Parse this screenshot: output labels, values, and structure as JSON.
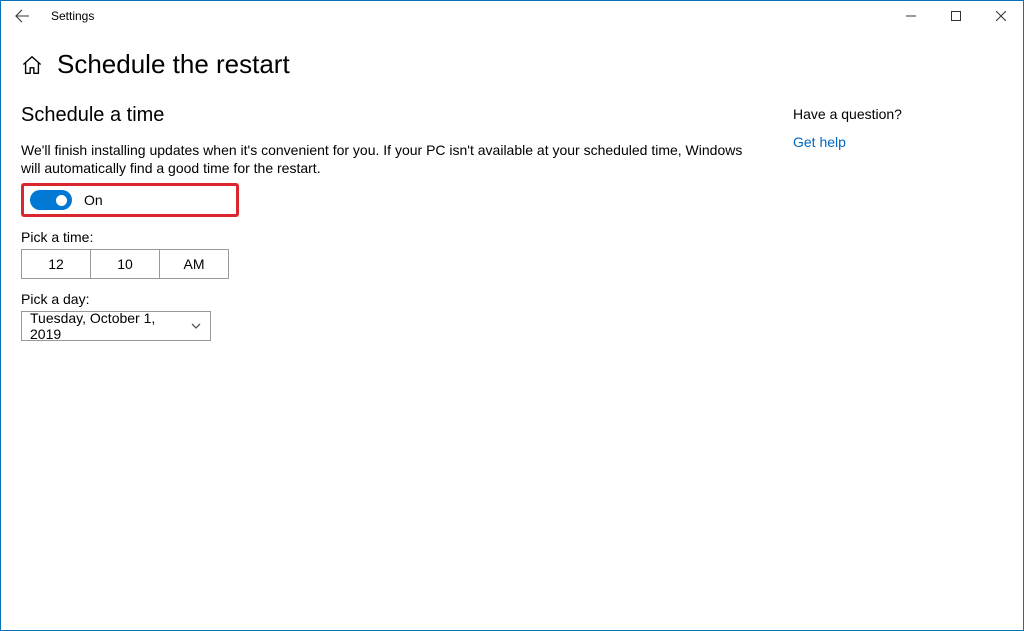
{
  "window": {
    "app_title": "Settings"
  },
  "header": {
    "page_title": "Schedule the restart"
  },
  "main": {
    "section_title": "Schedule a time",
    "description": "We'll finish installing updates when it's convenient for you. If your PC isn't available at your scheduled time, Windows will automatically find a good time for the restart.",
    "toggle": {
      "state": "on",
      "label": "On"
    },
    "pick_time": {
      "label": "Pick a time:",
      "hour": "12",
      "minute": "10",
      "ampm": "AM"
    },
    "pick_day": {
      "label": "Pick a day:",
      "value": "Tuesday, October 1, 2019"
    }
  },
  "side": {
    "question": "Have a question?",
    "help_link": "Get help"
  },
  "colors": {
    "accent": "#0078d4",
    "highlight_border": "#d9272d",
    "link": "#0067c0"
  }
}
